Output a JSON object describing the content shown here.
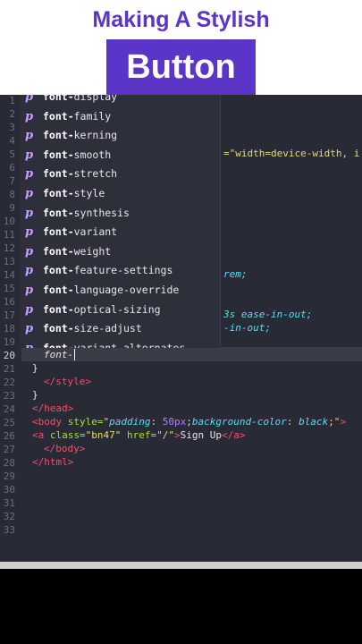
{
  "header": {
    "title_line1": "Making A Stylish",
    "title_line2": "Button"
  },
  "line_numbers": [
    "1",
    "2",
    "3",
    "4",
    "5",
    "6",
    "7",
    "8",
    "9",
    "10",
    "11",
    "12",
    "13",
    "14",
    "15",
    "16",
    "17",
    "18",
    "19",
    "20",
    "21",
    "22",
    "23",
    "24",
    "25",
    "26",
    "27",
    "28",
    "29",
    "30",
    "31",
    "32",
    "33"
  ],
  "current_line": "20",
  "autocomplete": {
    "items": [
      {
        "icon": "p",
        "label": "font-display"
      },
      {
        "icon": "p",
        "label": "font-family"
      },
      {
        "icon": "p",
        "label": "font-kerning"
      },
      {
        "icon": "p",
        "label": "font-smooth"
      },
      {
        "icon": "p",
        "label": "font-stretch"
      },
      {
        "icon": "p",
        "label": "font-style"
      },
      {
        "icon": "p",
        "label": "font-synthesis"
      },
      {
        "icon": "p",
        "label": "font-variant"
      },
      {
        "icon": "p",
        "label": "font-weight"
      },
      {
        "icon": "p",
        "label": "font-feature-settings"
      },
      {
        "icon": "p",
        "label": "font-language-override"
      },
      {
        "icon": "p",
        "label": "font-optical-sizing"
      },
      {
        "icon": "p",
        "label": "font-size-adjust"
      },
      {
        "icon": "p",
        "label": "font-variant-alternates"
      }
    ]
  },
  "code": {
    "l5_tail": "=\"width=device-width, i",
    "l14_tail": "rem;",
    "l17_tail": "3s ease-in-out;",
    "l18_tail": "-in-out;",
    "l20": "font-",
    "l21": "}",
    "l22": "</style>",
    "l23": "}",
    "l24": "</head>",
    "l25_tag": "<body",
    "l25_attr": " style=",
    "l25_q1": "\"",
    "l25_k1": "padding",
    "l25_c1": ": ",
    "l25_n1": "50px",
    "l25_s1": ";",
    "l25_k2": "background-color",
    "l25_c2": ": ",
    "l25_v2": "black",
    "l25_s2": ";\"",
    "l25_end": ">",
    "l26_tag": "<a",
    "l26_attr1": " class=",
    "l26_v1": "\"bn47\"",
    "l26_attr2": " href=",
    "l26_v2": "\"/\"",
    "l26_close": ">",
    "l26_text": "Sign Up",
    "l26_endtag": "</a>",
    "l27": "</body>",
    "l28": "</html>"
  },
  "colors": {
    "accent": "#5b35c8",
    "editor_bg": "#282a36",
    "tag": "#f0506e",
    "string": "#e6db74",
    "keyword": "#66d9ef"
  }
}
